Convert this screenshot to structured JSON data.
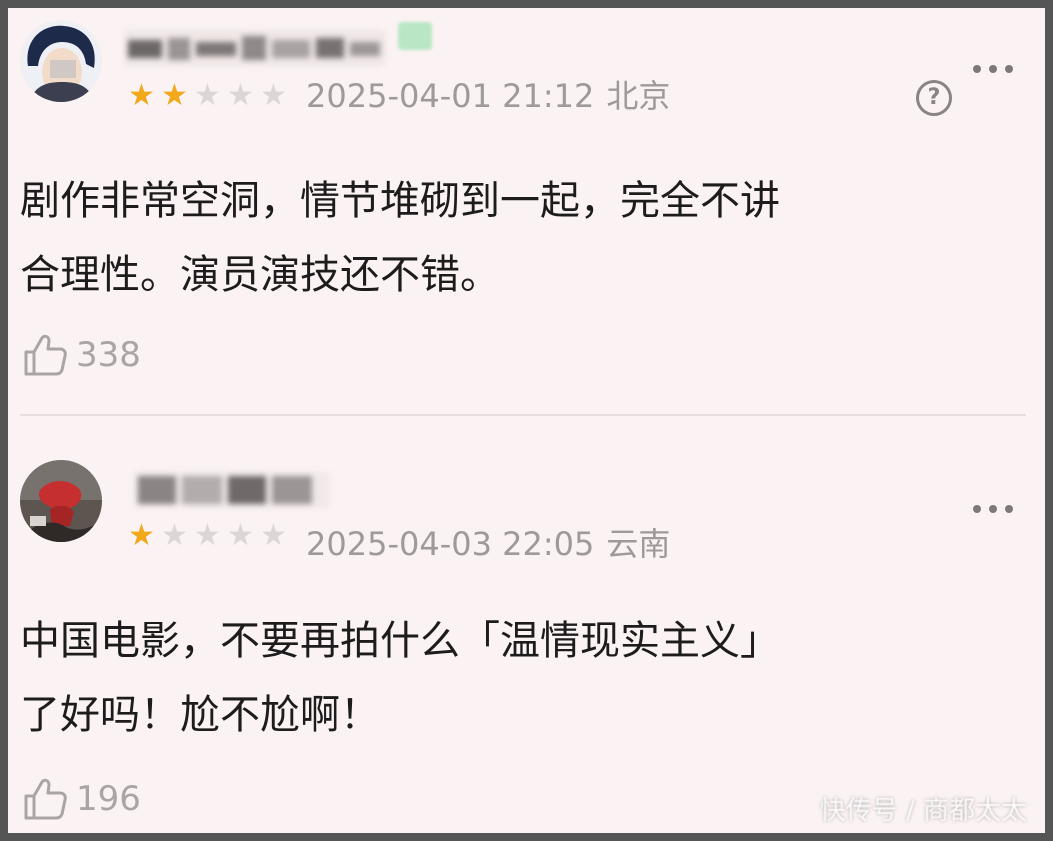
{
  "reviews": [
    {
      "rating": 2,
      "max_rating": 5,
      "date": "2025-04-01 21:12",
      "location": "北京",
      "content_lines": [
        "剧作非常空洞，情节堆砌到一起，完全不讲",
        "合理性。演员演技还不错。"
      ],
      "likes": "338"
    },
    {
      "rating": 1,
      "max_rating": 5,
      "date": "2025-04-03 22:05",
      "location": "云南",
      "content_lines": [
        "中国电影，不要再拍什么「温情现实主义」",
        "了好吗！尬不尬啊！"
      ],
      "likes": "196"
    }
  ],
  "colors": {
    "background": "#fbf3f3",
    "star_on": "#f2a81c",
    "star_off": "#dcd6d6",
    "meta_text": "#9f9a9a",
    "body_text": "#1c1c1c",
    "frame": "#555555"
  },
  "icons": {
    "more": "more-icon",
    "help": "help-icon",
    "like": "thumb-up-icon",
    "star": "star-icon"
  },
  "watermark": "快传号 / 商都太太"
}
